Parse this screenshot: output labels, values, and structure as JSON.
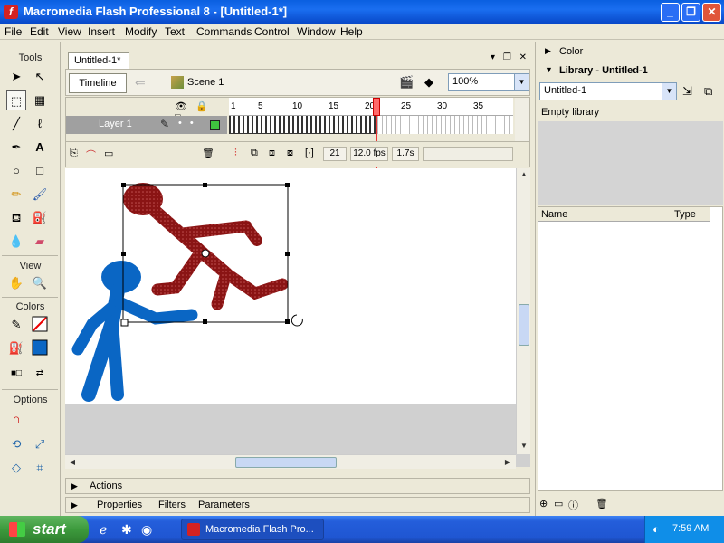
{
  "window": {
    "title": "Macromedia Flash Professional 8 - [Untitled-1*]",
    "app_icon": "f",
    "min_glyph": "_",
    "max_glyph": "❐",
    "close_glyph": "✕"
  },
  "menu": [
    "File",
    "Edit",
    "View",
    "Insert",
    "Modify",
    "Text",
    "Commands",
    "Control",
    "Window",
    "Help"
  ],
  "tools": {
    "title": "Tools",
    "view_label": "View",
    "colors_label": "Colors",
    "options_label": "Options"
  },
  "document": {
    "tab": "Untitled-1*",
    "timeline_button": "Timeline",
    "scene_label": "Scene 1",
    "zoom": "100%",
    "tab_controls": [
      "▾",
      "❐",
      "✕"
    ]
  },
  "timeline": {
    "ruler_ticks": [
      "1",
      "5",
      "10",
      "15",
      "20",
      "25",
      "30",
      "35"
    ],
    "layer_name": "Layer 1",
    "current_frame": "21",
    "fps": "12.0 fps",
    "time": "1.7s"
  },
  "panels": {
    "actions": "Actions",
    "properties": "Properties",
    "filters": "Filters",
    "parameters": "Parameters"
  },
  "right": {
    "color_panel": "Color",
    "library_panel": "Library - Untitled-1",
    "library_select": "Untitled-1",
    "empty_library": "Empty library",
    "col_name": "Name",
    "col_type": "Type"
  },
  "taskbar": {
    "start": "start",
    "task": "Macromedia Flash Pro...",
    "clock": "7:59 AM"
  },
  "colors": {
    "stick_blue": "#0a66c4",
    "stick_red": "#8a1414"
  }
}
